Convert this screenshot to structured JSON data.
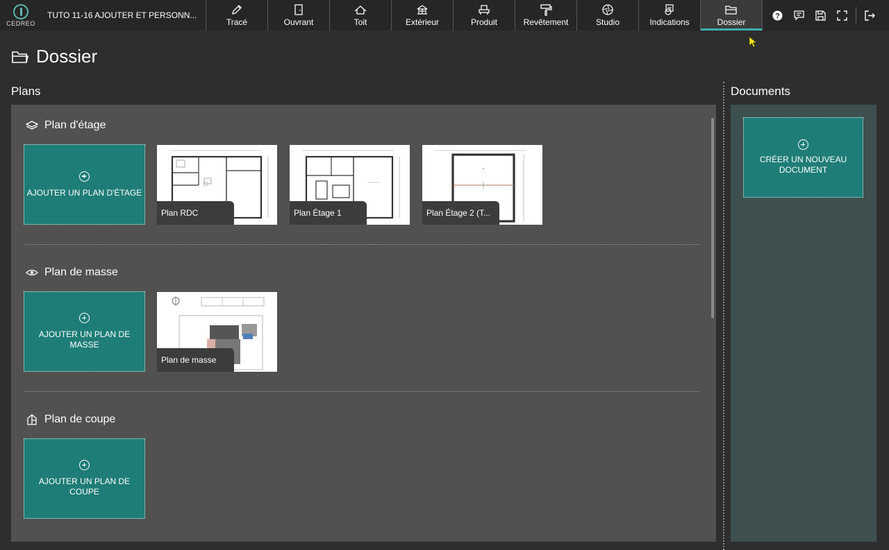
{
  "app": {
    "brand": "CEDREO",
    "project_title": "TUTO 11-16 AJOUTER ET PERSONN..."
  },
  "tabs": [
    {
      "label": "Tracé",
      "icon": "pencil-icon"
    },
    {
      "label": "Ouvrant",
      "icon": "door-icon"
    },
    {
      "label": "Toit",
      "icon": "roof-icon"
    },
    {
      "label": "Extérieur",
      "icon": "pergola-icon"
    },
    {
      "label": "Produit",
      "icon": "furniture-icon"
    },
    {
      "label": "Revêtement",
      "icon": "paint-roller-icon"
    },
    {
      "label": "Studio",
      "icon": "camera-aperture-icon"
    },
    {
      "label": "Indications",
      "icon": "annotation-icon"
    },
    {
      "label": "Dossier",
      "icon": "folder-icon",
      "active": true
    }
  ],
  "tools": [
    "help-icon",
    "comment-icon",
    "save-icon",
    "fullscreen-icon",
    "logout-icon"
  ],
  "page": {
    "title": "Dossier"
  },
  "plans": {
    "heading": "Plans",
    "floor": {
      "title": "Plan d'étage",
      "add_label": "AJOUTER UN PLAN D'ÉTAGE",
      "items": [
        "Plan RDC",
        "Plan Étage 1",
        "Plan Étage 2 (T..."
      ]
    },
    "mass": {
      "title": "Plan de masse",
      "add_label": "AJOUTER UN PLAN DE MASSE",
      "items": [
        "Plan de masse"
      ]
    },
    "section": {
      "title": "Plan de coupe",
      "add_label": "AJOUTER UN PLAN DE COUPE"
    }
  },
  "documents": {
    "heading": "Documents",
    "create_label_1": "CRÉER UN NOUVEAU",
    "create_label_2": "DOCUMENT"
  },
  "colors": {
    "accent": "#39b3ad",
    "tile": "#1f7d77",
    "panel": "#525150",
    "docs_panel": "#3d504f"
  }
}
